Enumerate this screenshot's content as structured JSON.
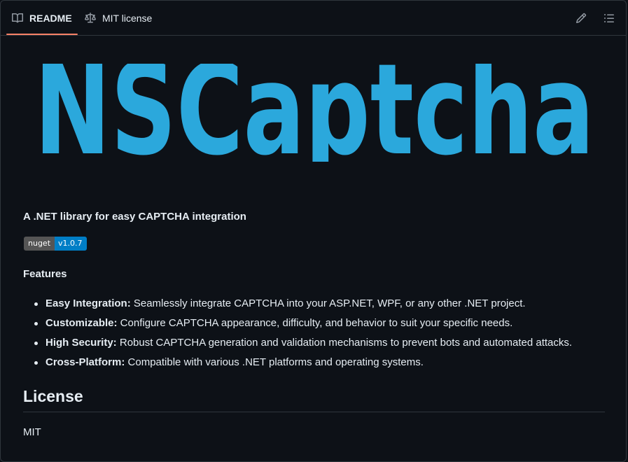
{
  "tabs": [
    {
      "label": "README",
      "icon": "book-icon",
      "active": true
    },
    {
      "label": "MIT license",
      "icon": "law-icon",
      "active": false
    }
  ],
  "toolbar": {
    "edit_icon": "pencil-icon",
    "toc_icon": "list-unordered-icon"
  },
  "logo": {
    "text": "NSCaptcha",
    "color": "#2ba8dc"
  },
  "readme": {
    "tagline": "A .NET library for easy CAPTCHA integration",
    "badge": {
      "label": "nuget",
      "value": "v1.0.7"
    },
    "features_heading": "Features",
    "features": [
      {
        "title": "Easy Integration:",
        "text": " Seamlessly integrate CAPTCHA into your ASP.NET, WPF, or any other .NET project."
      },
      {
        "title": "Customizable:",
        "text": " Configure CAPTCHA appearance, difficulty, and behavior to suit your specific needs."
      },
      {
        "title": "High Security:",
        "text": " Robust CAPTCHA generation and validation mechanisms to prevent bots and automated attacks."
      },
      {
        "title": "Cross-Platform:",
        "text": " Compatible with various .NET platforms and operating systems."
      }
    ],
    "license_heading": "License",
    "license_text": "MIT"
  },
  "colors": {
    "background": "#0d1117",
    "text": "#e6edf3",
    "border": "#30363d",
    "tab_underline": "#f78166",
    "badge_left": "#555555",
    "badge_right": "#007ec6"
  }
}
